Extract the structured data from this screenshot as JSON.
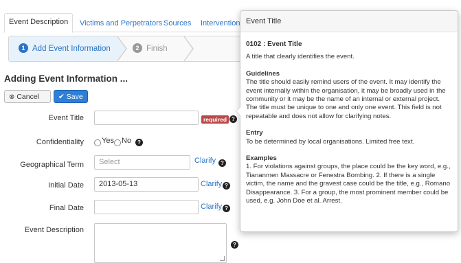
{
  "tabs": [
    {
      "label": "Event Description",
      "active": true
    },
    {
      "label": "Victims and Perpetrators"
    },
    {
      "label": "Sources"
    },
    {
      "label": "Interventions"
    }
  ],
  "wizard": {
    "steps": [
      {
        "number": "1",
        "label": "Add Event Information",
        "active": true
      },
      {
        "number": "2",
        "label": "Finish"
      }
    ]
  },
  "form": {
    "heading": "Adding Event Information ...",
    "cancel_label": "Cancel",
    "save_label": "Save",
    "event_title": {
      "label": "Event Title",
      "value": "",
      "required_badge": "required"
    },
    "confidentiality": {
      "label": "Confidentiality",
      "options": [
        "Yes",
        "No"
      ]
    },
    "geo_term": {
      "label": "Geographical Term",
      "placeholder": "Select",
      "clarify": "Clarify"
    },
    "initial_date": {
      "label": "Initial Date",
      "value": "2013-05-13",
      "clarify": "Clarify"
    },
    "final_date": {
      "label": "Final Date",
      "value": "",
      "clarify": "Clarify"
    },
    "event_description": {
      "label": "Event Description",
      "value": ""
    }
  },
  "popover": {
    "header": "Event Title",
    "code_title": "0102 : Event Title",
    "summary": "A title that clearly identifies the event.",
    "guidelines_heading": "Guidelines",
    "guidelines_text": "The title should easily remind users of the event. It may identify the event internally within the organisation, it may be broadly used in the community or it may be the name of an internal or external project. The title must be unique to one and only one event. This field is not repeatable and does not allow for clarifying notes.",
    "entry_heading": "Entry",
    "entry_text": "To be determined by local organisations. Limited free text.",
    "examples_heading": "Examples",
    "examples_text": "1. For violations against groups, the place could be the key word, e.g., Tiananmen Massacre or Fenestra Bombing. 2. If there is a single victim, the name and the gravest case could be the title, e.g., Romano Disappearance. 3. For a group, the most prominent member could be used, e.g. John Doe et al. Arrest."
  },
  "icons": {
    "help": "question-circle-icon",
    "cancel": "close-circle-icon",
    "save": "check-icon"
  },
  "colors": {
    "accent": "#2a74c8",
    "required": "#b94a48",
    "save_button": "#2f7fd6"
  }
}
